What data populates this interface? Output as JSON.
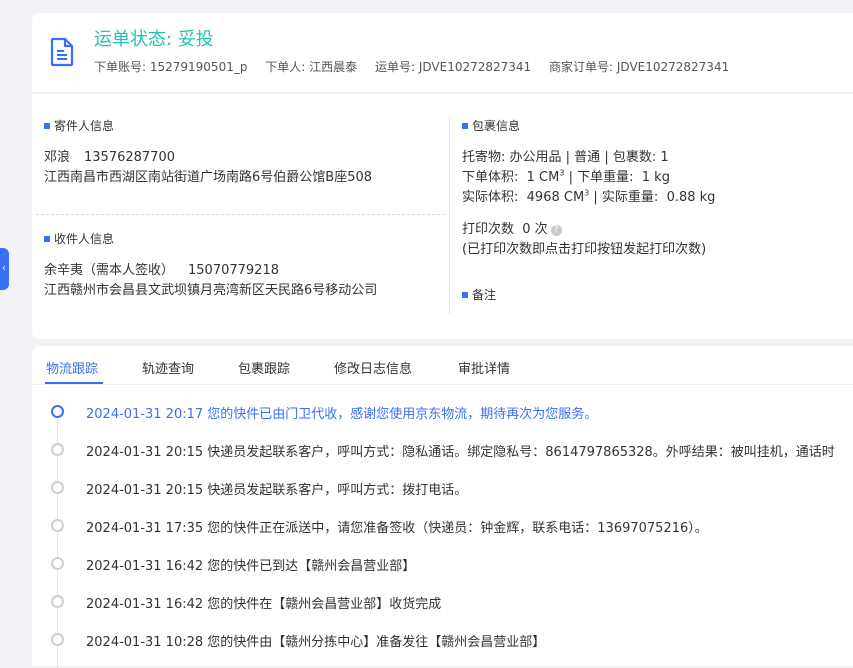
{
  "header": {
    "status": "运单状态: 妥投",
    "meta": [
      "下单账号: 15279190501_p",
      "下单人: 江西晨泰",
      "运单号: JDVE10272827341",
      "商家订单号: JDVE10272827341"
    ]
  },
  "sender": {
    "title": "寄件人信息",
    "name": "邓浪",
    "phone": "13576287700",
    "address": "江西南昌市西湖区南站街道广场南路6号伯爵公馆B座508"
  },
  "receiver": {
    "title": "收件人信息",
    "name": "余辛夷（需本人签收）",
    "phone": "15070779218",
    "address": "江西赣州市会昌县文武坝镇月亮湾新区天民路6号移动公司"
  },
  "package": {
    "title": "包裹信息",
    "goods_label": "托寄物:",
    "goods": "办公用品 | 普通",
    "count_label": "包裹数:",
    "count": "1",
    "order_volume_label": "下单体积:",
    "order_volume": "1 CM",
    "order_weight_label": "下单重量:",
    "order_weight": "1 kg",
    "actual_volume_label": "实际体积:",
    "actual_volume": "4968 CM",
    "actual_weight_label": "实际重量:",
    "actual_weight": "0.88 kg",
    "cube_sup": "3",
    "print_label": "打印次数",
    "print_count": "0 次",
    "print_note": "(已打印次数即点击打印按钮发起打印次数)"
  },
  "remark": {
    "title": "备注"
  },
  "tabs": [
    "物流跟踪",
    "轨迹查询",
    "包裹跟踪",
    "修改日志信息",
    "审批详情"
  ],
  "timeline": [
    "2024-01-31 20:17 您的快件已由门卫代收，感谢您使用京东物流，期待再次为您服务。",
    "2024-01-31 20:15 快递员发起联系客户，呼叫方式：隐私通话。绑定隐私号：8614797865328。外呼结果：被叫挂机，通话时",
    "2024-01-31 20:15 快递员发起联系客户，呼叫方式：拨打电话。",
    "2024-01-31 17:35 您的快件正在派送中，请您准备签收（快递员：钟金辉，联系电话：13697075216）。",
    "2024-01-31 16:42 您的快件已到达【赣州会昌营业部】",
    "2024-01-31 16:42 您的快件在【赣州会昌营业部】收货完成",
    "2024-01-31 10:28 您的快件由【赣州分拣中心】准备发往【赣州会昌营业部】"
  ],
  "watermark": "15279190501_p",
  "colors": {
    "accent": "#3a6ff7",
    "status": "#21c3b0"
  }
}
